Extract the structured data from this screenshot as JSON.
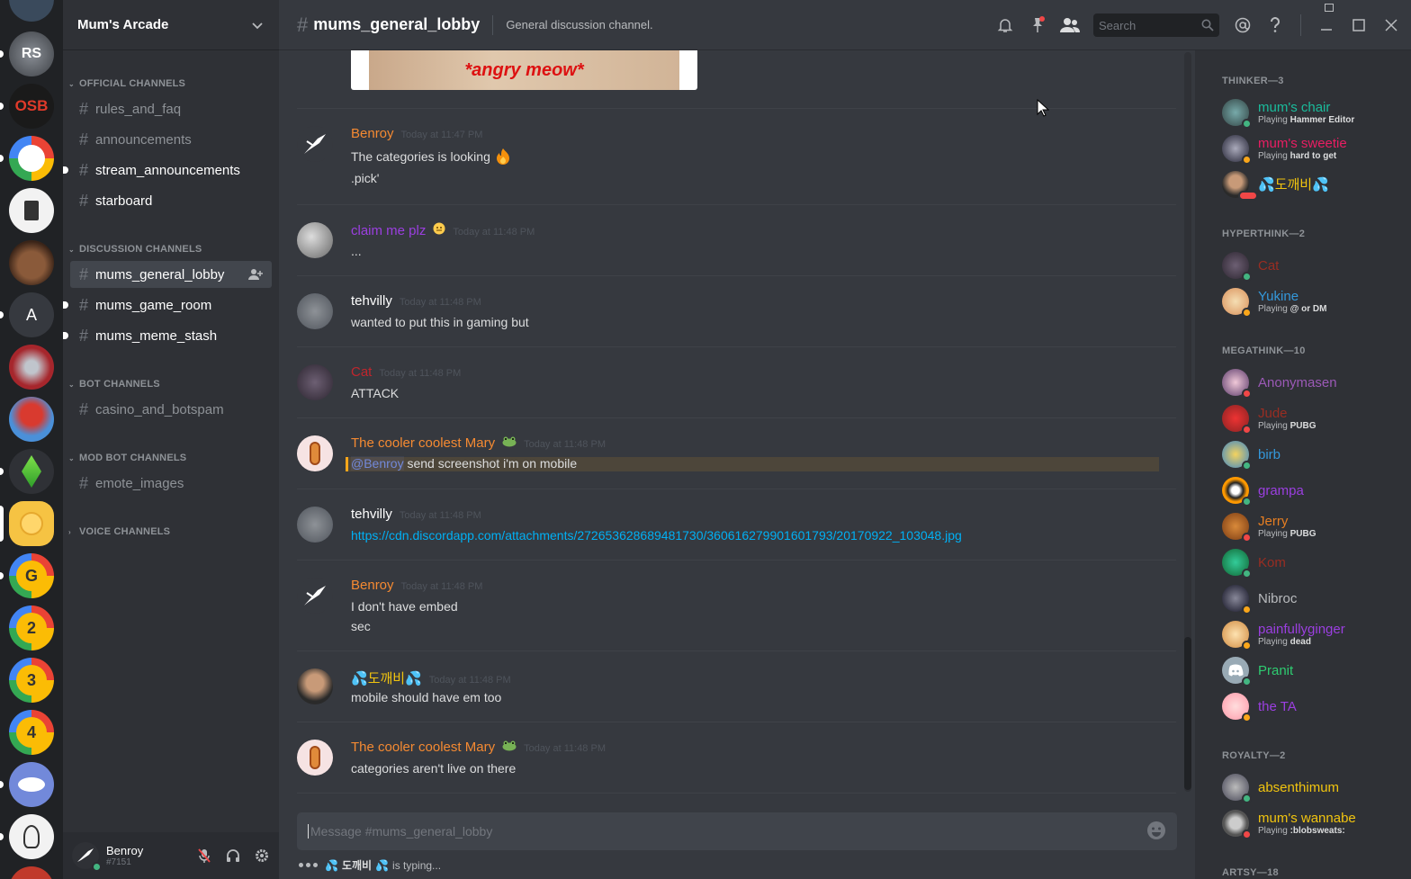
{
  "server": {
    "name": "Mum's Arcade"
  },
  "guild_labels": {
    "osb": "OSB",
    "a": "A",
    "g": "G",
    "two": "2",
    "three": "3",
    "four": "4"
  },
  "categories": {
    "official": "OFFICIAL CHANNELS",
    "discussion": "DISCUSSION CHANNELS",
    "bot": "BOT CHANNELS",
    "modbot": "MOD BOT CHANNELS",
    "voice": "VOICE CHANNELS"
  },
  "channels": {
    "rules": "rules_and_faq",
    "announcements": "announcements",
    "stream": "stream_announcements",
    "starboard": "starboard",
    "general": "mums_general_lobby",
    "game": "mums_game_room",
    "meme": "mums_meme_stash",
    "casino": "casino_and_botspam",
    "emote": "emote_images"
  },
  "current_user": {
    "name": "Benroy",
    "tag": "#7151"
  },
  "header": {
    "channel": "mums_general_lobby",
    "topic": "General discussion channel.",
    "search_placeholder": "Search"
  },
  "attachment_caption": "*angry meow*",
  "messages": [
    {
      "author": "Benroy",
      "time": "Today at 11:47 PM",
      "lines": [
        "The categories is looking",
        ".pick'"
      ]
    },
    {
      "author": "claim me plz",
      "time": "Today at 11:48 PM",
      "lines": [
        "..."
      ]
    },
    {
      "author": "tehvilly",
      "time": "Today at 11:48 PM",
      "lines": [
        "wanted to put this in gaming but"
      ]
    },
    {
      "author": "Cat",
      "time": "Today at 11:48 PM",
      "lines": [
        "ATTACK"
      ]
    },
    {
      "author": "The cooler coolest Mary",
      "time": "Today at 11:48 PM",
      "mention": "@Benroy",
      "lines": [
        "send screenshot i'm on mobile"
      ]
    },
    {
      "author": "tehvilly",
      "time": "Today at 11:48 PM",
      "lines": [
        "https://cdn.discordapp.com/attachments/272653628689481730/360616279901601793/20170922_103048.jpg"
      ]
    },
    {
      "author": "Benroy",
      "time": "Today at 11:48 PM",
      "lines": [
        "I don't have embed",
        "sec"
      ]
    },
    {
      "author": "도깨비",
      "time": "Today at 11:48 PM",
      "lines": [
        "mobile should have em too"
      ]
    },
    {
      "author": "The cooler coolest Mary",
      "time": "Today at 11:48 PM",
      "lines": [
        "categories aren't live on there"
      ]
    }
  ],
  "composer": {
    "placeholder": "Message #mums_general_lobby",
    "typing_user": "도깨비",
    "typing_suffix": "is typing..."
  },
  "member_groups": {
    "thinker": "THINKER—3",
    "hyperthink": "HYPERTHINK—2",
    "megathink": "MEGATHINK—10",
    "royalty": "ROYALTY—2",
    "artsy": "ARTSY—18"
  },
  "members": {
    "m1": {
      "name": "mum's chair",
      "playing": "Playing",
      "game": "Hammer Editor"
    },
    "m2": {
      "name": "mum's sweetie",
      "playing": "Playing",
      "game": "hard to get"
    },
    "m3": {
      "name": "도깨비"
    },
    "m4": {
      "name": "Cat"
    },
    "m5": {
      "name": "Yukine",
      "playing": "Playing",
      "game": "@ or DM"
    },
    "m6": {
      "name": "Anonymasen"
    },
    "m7": {
      "name": "Jude",
      "playing": "Playing",
      "game": "PUBG"
    },
    "m8": {
      "name": "birb"
    },
    "m9": {
      "name": "grampa"
    },
    "m10": {
      "name": "Jerry",
      "playing": "Playing",
      "game": "PUBG"
    },
    "m11": {
      "name": "Kom"
    },
    "m12": {
      "name": "Nibroc"
    },
    "m13": {
      "name": "painfullyginger",
      "playing": "Playing",
      "game": "dead"
    },
    "m14": {
      "name": "Pranit"
    },
    "m15": {
      "name": "the TA"
    },
    "m16": {
      "name": "absenthimum"
    },
    "m17": {
      "name": "mum's wannabe",
      "playing": "Playing",
      "game": ":blobsweats:"
    }
  },
  "colors": {
    "online": "#43b581",
    "idle": "#faa61a",
    "dnd": "#f04747",
    "link": "#00b0f4"
  }
}
